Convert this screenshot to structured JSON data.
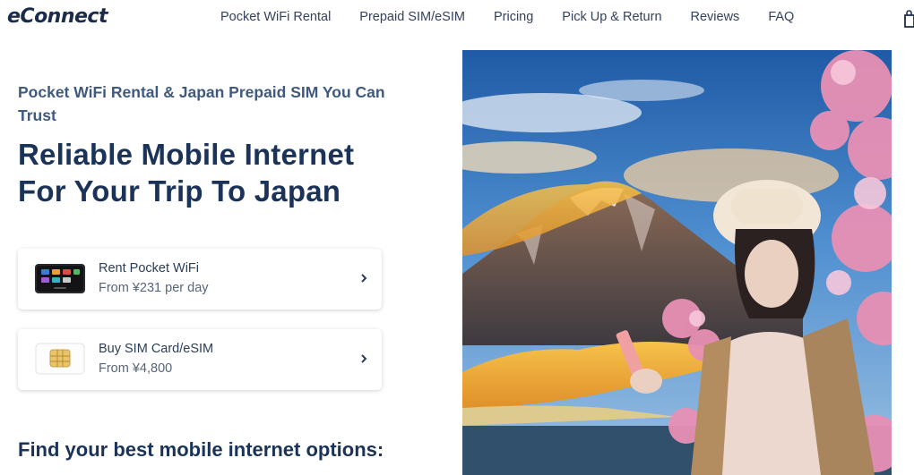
{
  "brand": {
    "logo_text": "eConnect"
  },
  "nav": {
    "items": [
      {
        "label": "Pocket WiFi Rental"
      },
      {
        "label": "Prepaid SIM/eSIM"
      },
      {
        "label": "Pricing"
      },
      {
        "label": "Pick Up & Return"
      },
      {
        "label": "Reviews"
      },
      {
        "label": "FAQ"
      }
    ],
    "cart_icon": "shopping-bag-icon"
  },
  "hero": {
    "tagline": "Pocket WiFi Rental & Japan Prepaid SIM You Can Trust",
    "headline_line1": "Reliable Mobile Internet",
    "headline_line2": "For Your Trip To Japan",
    "cards": [
      {
        "title": "Rent Pocket WiFi",
        "subtitle": "From ¥231 per day",
        "icon": "pocket-wifi-device-icon"
      },
      {
        "title": "Buy SIM Card/eSIM",
        "subtitle": "From ¥4,800",
        "icon": "sim-card-icon"
      }
    ],
    "image_subject": "traveler-with-mount-fuji-and-cherry-blossoms"
  },
  "section": {
    "find_heading": "Find your best mobile internet options:"
  },
  "colors": {
    "primary": "#1b3358",
    "tagline": "#3f5a80",
    "sky": "#2f6fb5",
    "blossom": "#e890b4"
  }
}
